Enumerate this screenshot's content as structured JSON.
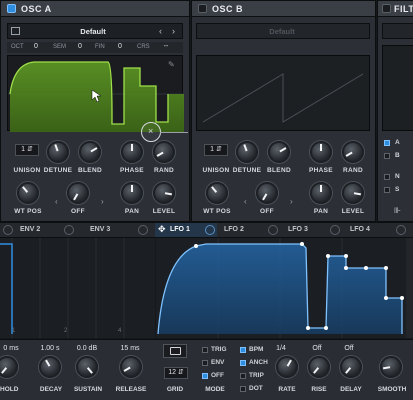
{
  "osc_a": {
    "title": "OSC A",
    "preset": "Default",
    "params": [
      {
        "key": "OCT",
        "value": "0"
      },
      {
        "key": "SEM",
        "value": "0"
      },
      {
        "key": "FIN",
        "value": "0"
      },
      {
        "key": "CRS",
        "value": "--"
      }
    ],
    "unison_value": "1",
    "knob_labels": [
      "UNISON",
      "DETUNE",
      "BLEND",
      "PHASE",
      "RAND"
    ],
    "row2_labels": [
      "WT POS",
      "OFF",
      "PAN",
      "LEVEL"
    ]
  },
  "osc_b": {
    "title": "OSC B",
    "preset": "Default",
    "unison_value": "1",
    "knob_labels": [
      "UNISON",
      "DETUNE",
      "BLEND",
      "PHASE",
      "RAND"
    ],
    "row2_labels": [
      "WT POS",
      "OFF",
      "PAN",
      "LEVEL"
    ]
  },
  "filter": {
    "title": "FILTE",
    "routing": [
      "A",
      "B",
      "N",
      "S"
    ]
  },
  "mod_tabs": {
    "env2": "ENV 2",
    "env3": "ENV 3",
    "lfo1": "LFO 1",
    "lfo2": "LFO 2",
    "lfo3": "LFO 3",
    "lfo4": "LFO 4"
  },
  "env_values": [
    "0 ms",
    "1.00 s",
    "0.0 dB",
    "15 ms"
  ],
  "env_labels": [
    "HOLD",
    "DECAY",
    "SUSTAIN",
    "RELEASE"
  ],
  "lfo": {
    "grid_value": "12",
    "grid_label": "GRID",
    "mode_options": [
      "TRIG",
      "ENV",
      "OFF"
    ],
    "mode_label": "MODE",
    "rate_options": [
      "BPM",
      "ANCH",
      "TRIP",
      "DOT"
    ],
    "rate_value": "1/4",
    "rise_value": "Off",
    "delay_value": "Off",
    "knob_labels": [
      "RATE",
      "RISE",
      "DELAY",
      "SMOOTH"
    ]
  },
  "colors": {
    "accent_blue": "#2f8de0",
    "wave_green": "#6aa22a",
    "lfo_blue": "#1f5a92"
  }
}
